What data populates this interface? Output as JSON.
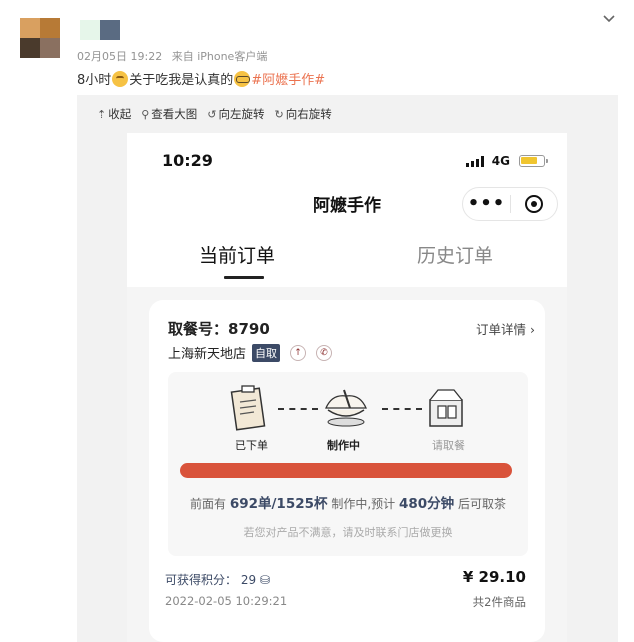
{
  "post": {
    "timestamp": "02月05日 19:22",
    "source": "来自 iPhone客户端",
    "text_before": "8小时",
    "text_middle": "关于吃我是认真的",
    "topic": "#阿嬷手作#",
    "avatar_colors": [
      "#d9a060",
      "#b77a36",
      "#4a3a2c",
      "#8a7060"
    ]
  },
  "toolbar": {
    "collapse": "收起",
    "view_large": "查看大图",
    "rotate_left": "向左旋转",
    "rotate_right": "向右旋转"
  },
  "phone": {
    "time": "10:29",
    "network": "4G",
    "app_title": "阿嬷手作",
    "capsule_more": "•••",
    "tabs": [
      {
        "label": "当前订单",
        "active": true
      },
      {
        "label": "历史订单",
        "active": false
      }
    ],
    "order": {
      "pickup_label": "取餐号：",
      "pickup_number": "8790",
      "detail_link": "订单详情 ›",
      "store": "上海新天地店",
      "badge": "自取",
      "steps": [
        "已下单",
        "制作中",
        "请取餐"
      ],
      "queue_prefix": "前面有",
      "queue_value": "692单/1525杯",
      "queue_mid": "制作中,预计",
      "queue_minutes": "480分钟",
      "queue_suffix": "后可取茶",
      "progress_fraction": 1.0,
      "hint": "若您对产品不满意，请及时联系门店做更换",
      "points_label": "可获得积分：",
      "points_value": "29",
      "price": "¥ 29.10",
      "datetime": "2022-02-05 10:29:21",
      "item_count": "共2件商品"
    }
  },
  "colors": {
    "accent_bar": "#d9533b",
    "navy": "#3c4a66",
    "topic": "#eb7350"
  }
}
